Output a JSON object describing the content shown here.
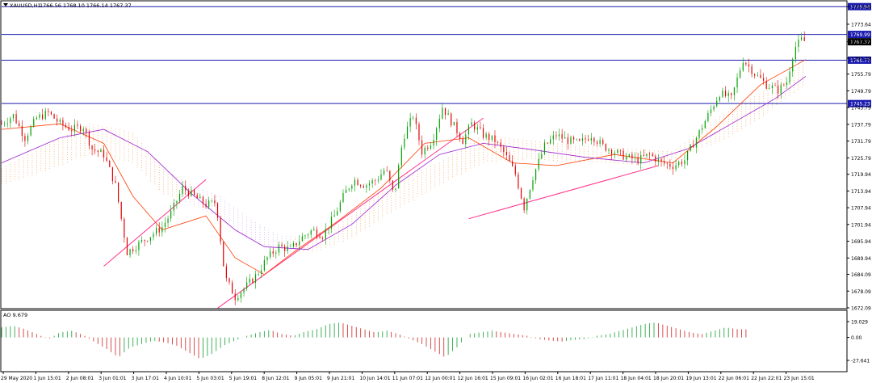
{
  "header": {
    "symbol": "XAUUSD,H1",
    "ohlc": "1766.56 1768.10 1766.14 1767.37"
  },
  "indicator": {
    "label": "AO 9.679"
  },
  "colors": {
    "background": "#ffffff",
    "frame": "#000000",
    "bull": "#00a000",
    "bear": "#e00000",
    "fast_ma": "#ff3b00",
    "slow_ma": "#9b20d0",
    "cloud_bull": "#f3a05a",
    "cloud_bear": "#c8a6e6",
    "trendline": "#ff2f8a",
    "hline": "#1a1ab0",
    "ao_up": "#2ea84a",
    "ao_down": "#d63a3a"
  },
  "chart_data": [
    {
      "type": "candlestick",
      "price_axis": {
        "ticks": [
          1779.94,
          1773.64,
          1767.37,
          1761.49,
          1755.79,
          1749.79,
          1743.79,
          1737.79,
          1731.79,
          1725.79,
          1719.94,
          1713.94,
          1707.94,
          1701.94,
          1695.94,
          1689.94,
          1684.09,
          1678.09,
          1672.09
        ],
        "ylim": [
          1672.09,
          1780.0
        ]
      },
      "time_axis": {
        "ticks": [
          "29 May 2020",
          "1 Jun 15:01",
          "2 Jun 08:01",
          "3 Jun 01:01",
          "3 Jun 17:01",
          "4 Jun 10:01",
          "5 Jun 03:01",
          "5 Jun 19:01",
          "8 Jun 12:01",
          "9 Jun 05:01",
          "9 Jun 21:01",
          "10 Jun 14:01",
          "11 Jun 07:01",
          "12 Jun 00:01",
          "12 Jun 16:01",
          "15 Jun 09:01",
          "16 Jun 02:01",
          "16 Jun 18:01",
          "17 Jun 11:01",
          "18 Jun 04:01",
          "18 Jun 20:01",
          "19 Jun 13:01",
          "22 Jun 06:01",
          "22 Jun 22:01",
          "23 Jun 15:01"
        ]
      },
      "horizontal_levels": [
        {
          "value": 1779.94,
          "label": "1779.94"
        },
        {
          "value": 1769.99,
          "label": "1769.99"
        },
        {
          "value": 1760.77,
          "label": "1760.77"
        },
        {
          "value": 1745.23,
          "label": "1745.23"
        }
      ],
      "current_price": {
        "value": 1767.37,
        "label": "1767.37"
      },
      "close_path": [
        [
          0,
          1738
        ],
        [
          8,
          1741
        ],
        [
          16,
          1733
        ],
        [
          24,
          1740
        ],
        [
          32,
          1742
        ],
        [
          40,
          1738
        ],
        [
          48,
          1736
        ],
        [
          56,
          1737
        ],
        [
          62,
          1729
        ],
        [
          70,
          1727
        ],
        [
          78,
          1716
        ],
        [
          86,
          1692
        ],
        [
          94,
          1695
        ],
        [
          102,
          1698
        ],
        [
          110,
          1701
        ],
        [
          116,
          1706
        ],
        [
          124,
          1715
        ],
        [
          132,
          1712
        ],
        [
          140,
          1709
        ],
        [
          147,
          1710
        ],
        [
          153,
          1683
        ],
        [
          160,
          1676
        ],
        [
          168,
          1680
        ],
        [
          175,
          1684
        ],
        [
          182,
          1690
        ],
        [
          190,
          1694
        ],
        [
          198,
          1693
        ],
        [
          205,
          1697
        ],
        [
          213,
          1700
        ],
        [
          220,
          1698
        ],
        [
          228,
          1705
        ],
        [
          235,
          1713
        ],
        [
          241,
          1718
        ],
        [
          249,
          1716
        ],
        [
          257,
          1718
        ],
        [
          263,
          1722
        ],
        [
          269,
          1712
        ],
        [
          275,
          1733
        ],
        [
          282,
          1741
        ],
        [
          288,
          1728
        ],
        [
          295,
          1732
        ],
        [
          302,
          1744
        ],
        [
          309,
          1738
        ],
        [
          316,
          1732
        ],
        [
          322,
          1738
        ],
        [
          330,
          1734
        ],
        [
          338,
          1732
        ],
        [
          345,
          1727
        ],
        [
          352,
          1720
        ],
        [
          358,
          1708
        ],
        [
          364,
          1719
        ],
        [
          372,
          1730
        ],
        [
          380,
          1734
        ],
        [
          388,
          1732
        ],
        [
          396,
          1731
        ],
        [
          404,
          1734
        ],
        [
          412,
          1730
        ],
        [
          420,
          1728
        ],
        [
          428,
          1726
        ],
        [
          436,
          1725
        ],
        [
          444,
          1727
        ],
        [
          452,
          1724
        ],
        [
          460,
          1723
        ],
        [
          468,
          1725
        ],
        [
          476,
          1733
        ],
        [
          484,
          1741
        ],
        [
          492,
          1749
        ],
        [
          500,
          1747
        ],
        [
          508,
          1761
        ],
        [
          516,
          1756
        ],
        [
          524,
          1752
        ],
        [
          532,
          1750
        ],
        [
          538,
          1753
        ],
        [
          543,
          1765
        ],
        [
          548,
          1768
        ],
        [
          551,
          1767.37
        ]
      ],
      "moving_averages": [
        {
          "role": "fast",
          "points": [
            [
              0,
              1736
            ],
            [
              40,
              1738
            ],
            [
              70,
              1731
            ],
            [
              90,
              1712
            ],
            [
              110,
              1700
            ],
            [
              140,
              1705
            ],
            [
              160,
              1690
            ],
            [
              180,
              1684
            ],
            [
              200,
              1692
            ],
            [
              230,
              1703
            ],
            [
              260,
              1715
            ],
            [
              290,
              1731
            ],
            [
              320,
              1733
            ],
            [
              350,
              1724
            ],
            [
              380,
              1723
            ],
            [
              420,
              1727
            ],
            [
              460,
              1724
            ],
            [
              490,
              1737
            ],
            [
              520,
              1752
            ],
            [
              551,
              1761
            ]
          ]
        },
        {
          "role": "slow",
          "points": [
            [
              0,
              1724
            ],
            [
              40,
              1733
            ],
            [
              70,
              1736
            ],
            [
              100,
              1728
            ],
            [
              130,
              1713
            ],
            [
              160,
              1700
            ],
            [
              180,
              1694
            ],
            [
              210,
              1693
            ],
            [
              240,
              1702
            ],
            [
              270,
              1716
            ],
            [
              300,
              1727
            ],
            [
              330,
              1731
            ],
            [
              360,
              1729
            ],
            [
              400,
              1726
            ],
            [
              440,
              1724
            ],
            [
              470,
              1729
            ],
            [
              500,
              1738
            ],
            [
              530,
              1747
            ],
            [
              551,
              1755
            ]
          ]
        }
      ],
      "trendlines": [
        {
          "from": [
            70,
            1687
          ],
          "to": [
            140,
            1718
          ]
        },
        {
          "from": [
            148,
            1672
          ],
          "to": [
            330,
            1740
          ]
        },
        {
          "from": [
            320,
            1704
          ],
          "to": [
            450,
            1723
          ]
        }
      ],
      "ichimoku_cloud": {
        "upper": [
          [
            0,
            1722
          ],
          [
            30,
            1730
          ],
          [
            60,
            1738
          ],
          [
            90,
            1735
          ],
          [
            110,
            1722
          ],
          [
            130,
            1716
          ],
          [
            150,
            1712
          ],
          [
            170,
            1704
          ],
          [
            190,
            1698
          ],
          [
            215,
            1697
          ],
          [
            240,
            1705
          ],
          [
            270,
            1718
          ],
          [
            300,
            1724
          ],
          [
            330,
            1734
          ],
          [
            360,
            1732
          ],
          [
            400,
            1730
          ],
          [
            430,
            1729
          ],
          [
            460,
            1728
          ],
          [
            490,
            1740
          ],
          [
            520,
            1749
          ],
          [
            551,
            1760
          ]
        ],
        "lower": [
          [
            0,
            1716
          ],
          [
            30,
            1721
          ],
          [
            60,
            1727
          ],
          [
            90,
            1724
          ],
          [
            110,
            1713
          ],
          [
            130,
            1709
          ],
          [
            150,
            1704
          ],
          [
            170,
            1696
          ],
          [
            190,
            1692
          ],
          [
            215,
            1692
          ],
          [
            240,
            1697
          ],
          [
            270,
            1707
          ],
          [
            300,
            1716
          ],
          [
            330,
            1724
          ],
          [
            360,
            1725
          ],
          [
            400,
            1724
          ],
          [
            430,
            1723
          ],
          [
            460,
            1725
          ],
          [
            490,
            1731
          ],
          [
            520,
            1740
          ],
          [
            551,
            1752
          ]
        ]
      }
    },
    {
      "type": "bar",
      "name": "AO",
      "axis_ticks": [
        19.029,
        0.0,
        -27.641
      ],
      "ylim": [
        -27.641,
        19.029
      ],
      "bars": [
        {
          "x": 0,
          "v": 12
        },
        {
          "x": 8,
          "v": 14
        },
        {
          "x": 16,
          "v": 10
        },
        {
          "x": 24,
          "v": 4
        },
        {
          "x": 32,
          "v": -2
        },
        {
          "x": 40,
          "v": 6
        },
        {
          "x": 48,
          "v": 8
        },
        {
          "x": 56,
          "v": 3
        },
        {
          "x": 64,
          "v": -6
        },
        {
          "x": 72,
          "v": -14
        },
        {
          "x": 80,
          "v": -24
        },
        {
          "x": 88,
          "v": -12
        },
        {
          "x": 96,
          "v": -8
        },
        {
          "x": 104,
          "v": -4
        },
        {
          "x": 112,
          "v": -6
        },
        {
          "x": 120,
          "v": -10
        },
        {
          "x": 128,
          "v": -18
        },
        {
          "x": 136,
          "v": -26
        },
        {
          "x": 144,
          "v": -20
        },
        {
          "x": 152,
          "v": -10
        },
        {
          "x": 160,
          "v": -4
        },
        {
          "x": 168,
          "v": 2
        },
        {
          "x": 176,
          "v": 6
        },
        {
          "x": 184,
          "v": 9
        },
        {
          "x": 192,
          "v": 4
        },
        {
          "x": 200,
          "v": 2
        },
        {
          "x": 208,
          "v": 7
        },
        {
          "x": 216,
          "v": 10
        },
        {
          "x": 224,
          "v": 16
        },
        {
          "x": 232,
          "v": 18
        },
        {
          "x": 240,
          "v": 14
        },
        {
          "x": 248,
          "v": 10
        },
        {
          "x": 256,
          "v": 6
        },
        {
          "x": 264,
          "v": 8
        },
        {
          "x": 272,
          "v": 4
        },
        {
          "x": 280,
          "v": -2
        },
        {
          "x": 288,
          "v": -8
        },
        {
          "x": 296,
          "v": -16
        },
        {
          "x": 304,
          "v": -24
        },
        {
          "x": 312,
          "v": -12
        },
        {
          "x": 320,
          "v": 4
        },
        {
          "x": 328,
          "v": 6
        },
        {
          "x": 336,
          "v": 8
        },
        {
          "x": 344,
          "v": 6
        },
        {
          "x": 352,
          "v": 4
        },
        {
          "x": 360,
          "v": 2
        },
        {
          "x": 368,
          "v": -2
        },
        {
          "x": 376,
          "v": -4
        },
        {
          "x": 384,
          "v": -5
        },
        {
          "x": 392,
          "v": -3
        },
        {
          "x": 400,
          "v": -2
        },
        {
          "x": 408,
          "v": 2
        },
        {
          "x": 416,
          "v": 4
        },
        {
          "x": 424,
          "v": 8
        },
        {
          "x": 432,
          "v": 12
        },
        {
          "x": 440,
          "v": 16
        },
        {
          "x": 448,
          "v": 18
        },
        {
          "x": 456,
          "v": 14
        },
        {
          "x": 464,
          "v": 10
        },
        {
          "x": 472,
          "v": 6
        },
        {
          "x": 480,
          "v": 4
        },
        {
          "x": 488,
          "v": 8
        },
        {
          "x": 496,
          "v": 12
        },
        {
          "x": 504,
          "v": 10
        },
        {
          "x": 512,
          "v": 9.679
        }
      ]
    }
  ]
}
